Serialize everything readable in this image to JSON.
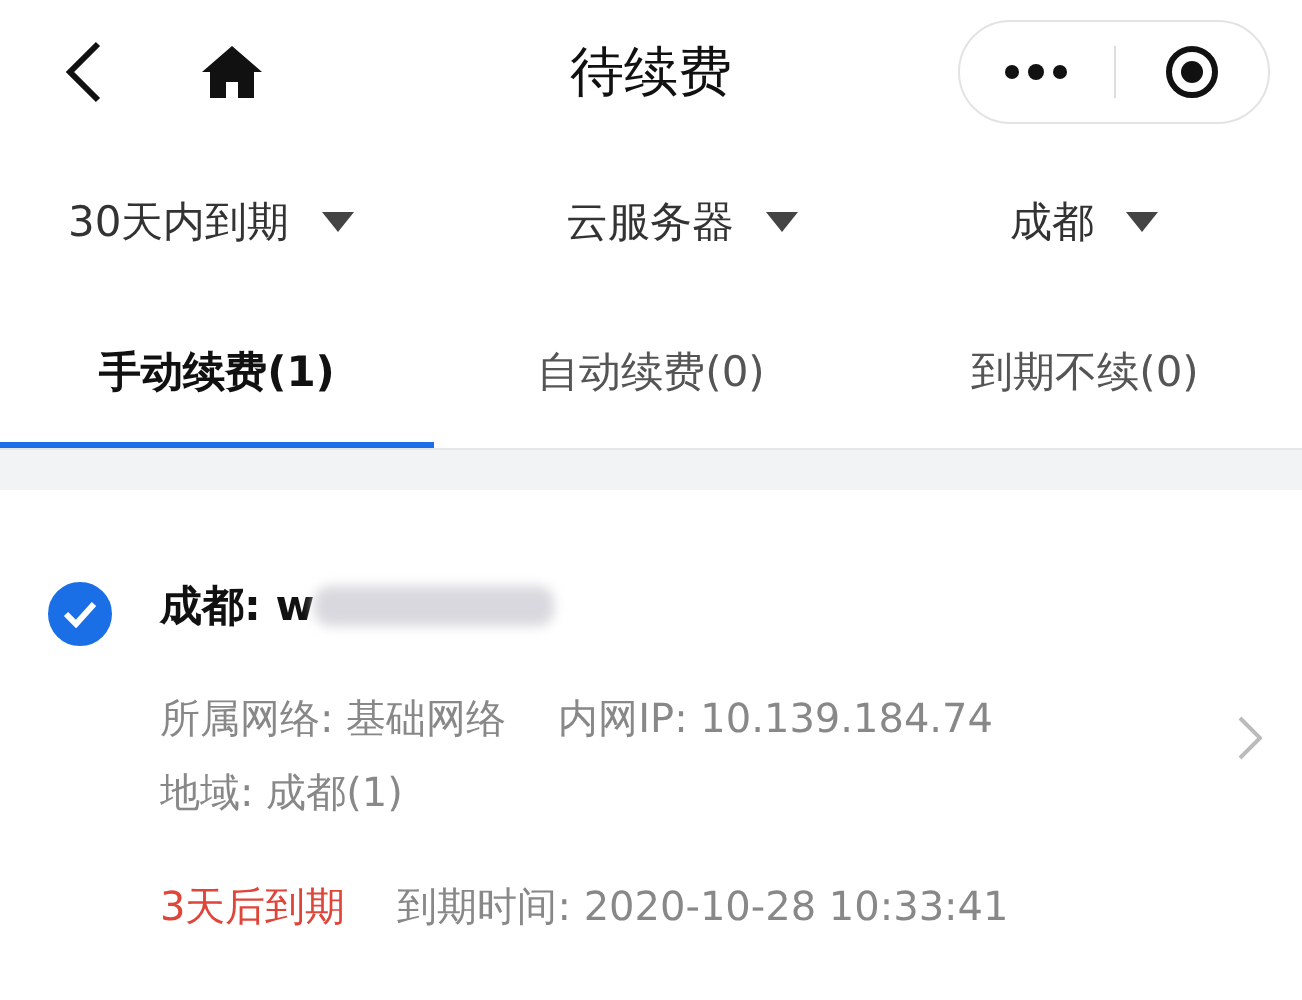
{
  "nav": {
    "title": "待续费"
  },
  "filters": [
    {
      "label": "30天内到期"
    },
    {
      "label": "云服务器"
    },
    {
      "label": "成都"
    }
  ],
  "tabs": [
    {
      "label": "手动续费(1)",
      "selected": true
    },
    {
      "label": "自动续费(0)",
      "selected": false
    },
    {
      "label": "到期不续(0)",
      "selected": false
    }
  ],
  "items": [
    {
      "checked": true,
      "name": "成都: w",
      "network": "所属网络: 基础网络",
      "ip": "内网IP: 10.139.184.74",
      "region": "地域: 成都(1)",
      "status": "3天后到期",
      "expiry": "到期时间: 2020-10-28 10:33:41"
    }
  ]
}
